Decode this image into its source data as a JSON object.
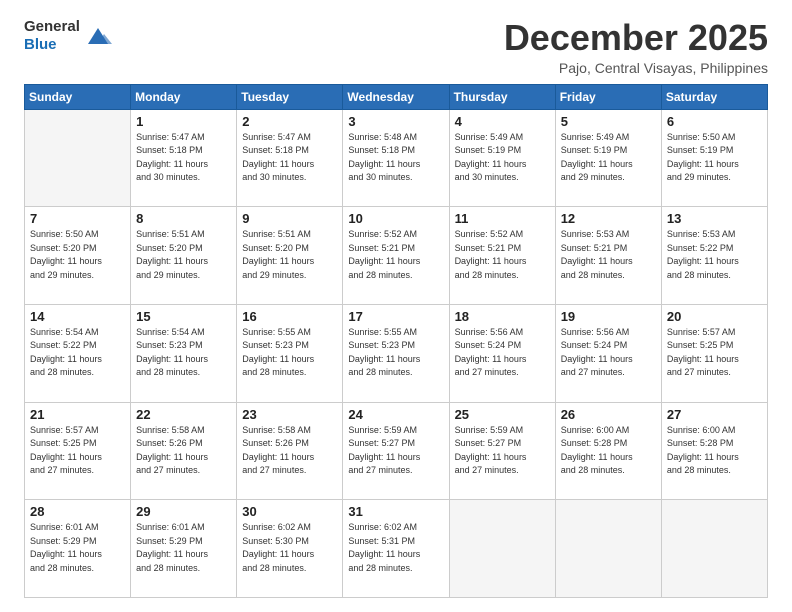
{
  "header": {
    "logo_line1": "General",
    "logo_line2": "Blue",
    "month": "December 2025",
    "location": "Pajo, Central Visayas, Philippines"
  },
  "days_of_week": [
    "Sunday",
    "Monday",
    "Tuesday",
    "Wednesday",
    "Thursday",
    "Friday",
    "Saturday"
  ],
  "weeks": [
    [
      {
        "day": "",
        "info": ""
      },
      {
        "day": "1",
        "info": "Sunrise: 5:47 AM\nSunset: 5:18 PM\nDaylight: 11 hours\nand 30 minutes."
      },
      {
        "day": "2",
        "info": "Sunrise: 5:47 AM\nSunset: 5:18 PM\nDaylight: 11 hours\nand 30 minutes."
      },
      {
        "day": "3",
        "info": "Sunrise: 5:48 AM\nSunset: 5:18 PM\nDaylight: 11 hours\nand 30 minutes."
      },
      {
        "day": "4",
        "info": "Sunrise: 5:49 AM\nSunset: 5:19 PM\nDaylight: 11 hours\nand 30 minutes."
      },
      {
        "day": "5",
        "info": "Sunrise: 5:49 AM\nSunset: 5:19 PM\nDaylight: 11 hours\nand 29 minutes."
      },
      {
        "day": "6",
        "info": "Sunrise: 5:50 AM\nSunset: 5:19 PM\nDaylight: 11 hours\nand 29 minutes."
      }
    ],
    [
      {
        "day": "7",
        "info": "Sunrise: 5:50 AM\nSunset: 5:20 PM\nDaylight: 11 hours\nand 29 minutes."
      },
      {
        "day": "8",
        "info": "Sunrise: 5:51 AM\nSunset: 5:20 PM\nDaylight: 11 hours\nand 29 minutes."
      },
      {
        "day": "9",
        "info": "Sunrise: 5:51 AM\nSunset: 5:20 PM\nDaylight: 11 hours\nand 29 minutes."
      },
      {
        "day": "10",
        "info": "Sunrise: 5:52 AM\nSunset: 5:21 PM\nDaylight: 11 hours\nand 28 minutes."
      },
      {
        "day": "11",
        "info": "Sunrise: 5:52 AM\nSunset: 5:21 PM\nDaylight: 11 hours\nand 28 minutes."
      },
      {
        "day": "12",
        "info": "Sunrise: 5:53 AM\nSunset: 5:21 PM\nDaylight: 11 hours\nand 28 minutes."
      },
      {
        "day": "13",
        "info": "Sunrise: 5:53 AM\nSunset: 5:22 PM\nDaylight: 11 hours\nand 28 minutes."
      }
    ],
    [
      {
        "day": "14",
        "info": "Sunrise: 5:54 AM\nSunset: 5:22 PM\nDaylight: 11 hours\nand 28 minutes."
      },
      {
        "day": "15",
        "info": "Sunrise: 5:54 AM\nSunset: 5:23 PM\nDaylight: 11 hours\nand 28 minutes."
      },
      {
        "day": "16",
        "info": "Sunrise: 5:55 AM\nSunset: 5:23 PM\nDaylight: 11 hours\nand 28 minutes."
      },
      {
        "day": "17",
        "info": "Sunrise: 5:55 AM\nSunset: 5:23 PM\nDaylight: 11 hours\nand 28 minutes."
      },
      {
        "day": "18",
        "info": "Sunrise: 5:56 AM\nSunset: 5:24 PM\nDaylight: 11 hours\nand 27 minutes."
      },
      {
        "day": "19",
        "info": "Sunrise: 5:56 AM\nSunset: 5:24 PM\nDaylight: 11 hours\nand 27 minutes."
      },
      {
        "day": "20",
        "info": "Sunrise: 5:57 AM\nSunset: 5:25 PM\nDaylight: 11 hours\nand 27 minutes."
      }
    ],
    [
      {
        "day": "21",
        "info": "Sunrise: 5:57 AM\nSunset: 5:25 PM\nDaylight: 11 hours\nand 27 minutes."
      },
      {
        "day": "22",
        "info": "Sunrise: 5:58 AM\nSunset: 5:26 PM\nDaylight: 11 hours\nand 27 minutes."
      },
      {
        "day": "23",
        "info": "Sunrise: 5:58 AM\nSunset: 5:26 PM\nDaylight: 11 hours\nand 27 minutes."
      },
      {
        "day": "24",
        "info": "Sunrise: 5:59 AM\nSunset: 5:27 PM\nDaylight: 11 hours\nand 27 minutes."
      },
      {
        "day": "25",
        "info": "Sunrise: 5:59 AM\nSunset: 5:27 PM\nDaylight: 11 hours\nand 27 minutes."
      },
      {
        "day": "26",
        "info": "Sunrise: 6:00 AM\nSunset: 5:28 PM\nDaylight: 11 hours\nand 28 minutes."
      },
      {
        "day": "27",
        "info": "Sunrise: 6:00 AM\nSunset: 5:28 PM\nDaylight: 11 hours\nand 28 minutes."
      }
    ],
    [
      {
        "day": "28",
        "info": "Sunrise: 6:01 AM\nSunset: 5:29 PM\nDaylight: 11 hours\nand 28 minutes."
      },
      {
        "day": "29",
        "info": "Sunrise: 6:01 AM\nSunset: 5:29 PM\nDaylight: 11 hours\nand 28 minutes."
      },
      {
        "day": "30",
        "info": "Sunrise: 6:02 AM\nSunset: 5:30 PM\nDaylight: 11 hours\nand 28 minutes."
      },
      {
        "day": "31",
        "info": "Sunrise: 6:02 AM\nSunset: 5:31 PM\nDaylight: 11 hours\nand 28 minutes."
      },
      {
        "day": "",
        "info": ""
      },
      {
        "day": "",
        "info": ""
      },
      {
        "day": "",
        "info": ""
      }
    ]
  ]
}
